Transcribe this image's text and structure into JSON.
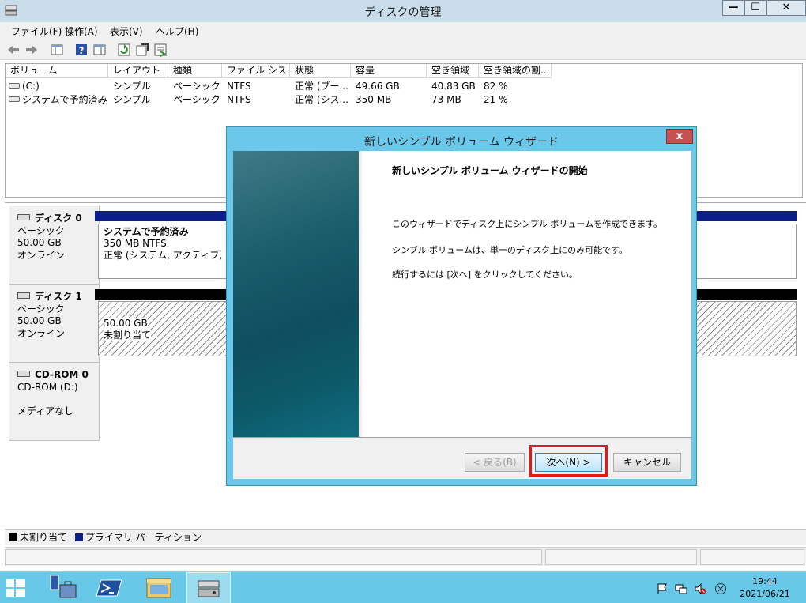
{
  "window": {
    "title": "ディスクの管理",
    "controls": {
      "minimize": "—",
      "maximize": "☐",
      "close": "✕"
    }
  },
  "menu": [
    "ファイル(F)",
    "操作(A)",
    "表示(V)",
    "ヘルプ(H)"
  ],
  "toolbar_icons": [
    "back-arrow-icon",
    "forward-arrow-icon",
    "console-tree-icon",
    "help-icon",
    "show-hide-icon",
    "refresh-icon",
    "properties-icon",
    "export-icon"
  ],
  "volume_table": {
    "columns": [
      "ボリューム",
      "レイアウト",
      "種類",
      "ファイル シス...",
      "状態",
      "容量",
      "空き領域",
      "空き領域の割..."
    ],
    "rows": [
      [
        "(C:)",
        "シンプル",
        "ベーシック",
        "NTFS",
        "正常 (ブー...",
        "49.66 GB",
        "40.83 GB",
        "82 %"
      ],
      [
        "システムで予約済み",
        "シンプル",
        "ベーシック",
        "NTFS",
        "正常 (シス...",
        "350 MB",
        "73 MB",
        "21 %"
      ]
    ]
  },
  "disks": [
    {
      "name": "ディスク 0",
      "type": "ベーシック",
      "size": "50.00 GB",
      "status": "オンライン",
      "partition": {
        "title": "システムで予約済み",
        "line2": "350 MB NTFS",
        "line3": "正常 (システム, アクティブ, プライマ"
      }
    },
    {
      "name": "ディスク 1",
      "type": "ベーシック",
      "size": "50.00 GB",
      "status": "オンライン",
      "partition": {
        "line1": "50.00 GB",
        "line2": "未割り当て"
      }
    },
    {
      "name": "CD-ROM 0",
      "type": "CD-ROM (D:)",
      "size": "",
      "status": "メディアなし"
    }
  ],
  "legend": {
    "unallocated": "未割り当て",
    "primary": "プライマリ パーティション",
    "unallocated_color": "#000000",
    "primary_color": "#0b1e8a"
  },
  "wizard": {
    "title": "新しいシンプル ボリューム ウィザード",
    "close": "x",
    "heading": "新しいシンプル ボリューム ウィザードの開始",
    "paragraphs": [
      "このウィザードでディスク上にシンプル ボリュームを作成できます。",
      "シンプル ボリュームは、単一のディスク上にのみ可能です。",
      "続行するには [次へ] をクリックしてください。"
    ],
    "buttons": {
      "back": "< 戻る(B)",
      "next": "次へ(N) >",
      "cancel": "キャンセル"
    },
    "highlight_color": "#e41818"
  },
  "taskbar": {
    "apps": [
      "start-icon",
      "server-manager-icon",
      "powershell-icon",
      "file-explorer-icon",
      "disk-management-icon"
    ],
    "time": "19:44",
    "date": "2021/06/21"
  }
}
